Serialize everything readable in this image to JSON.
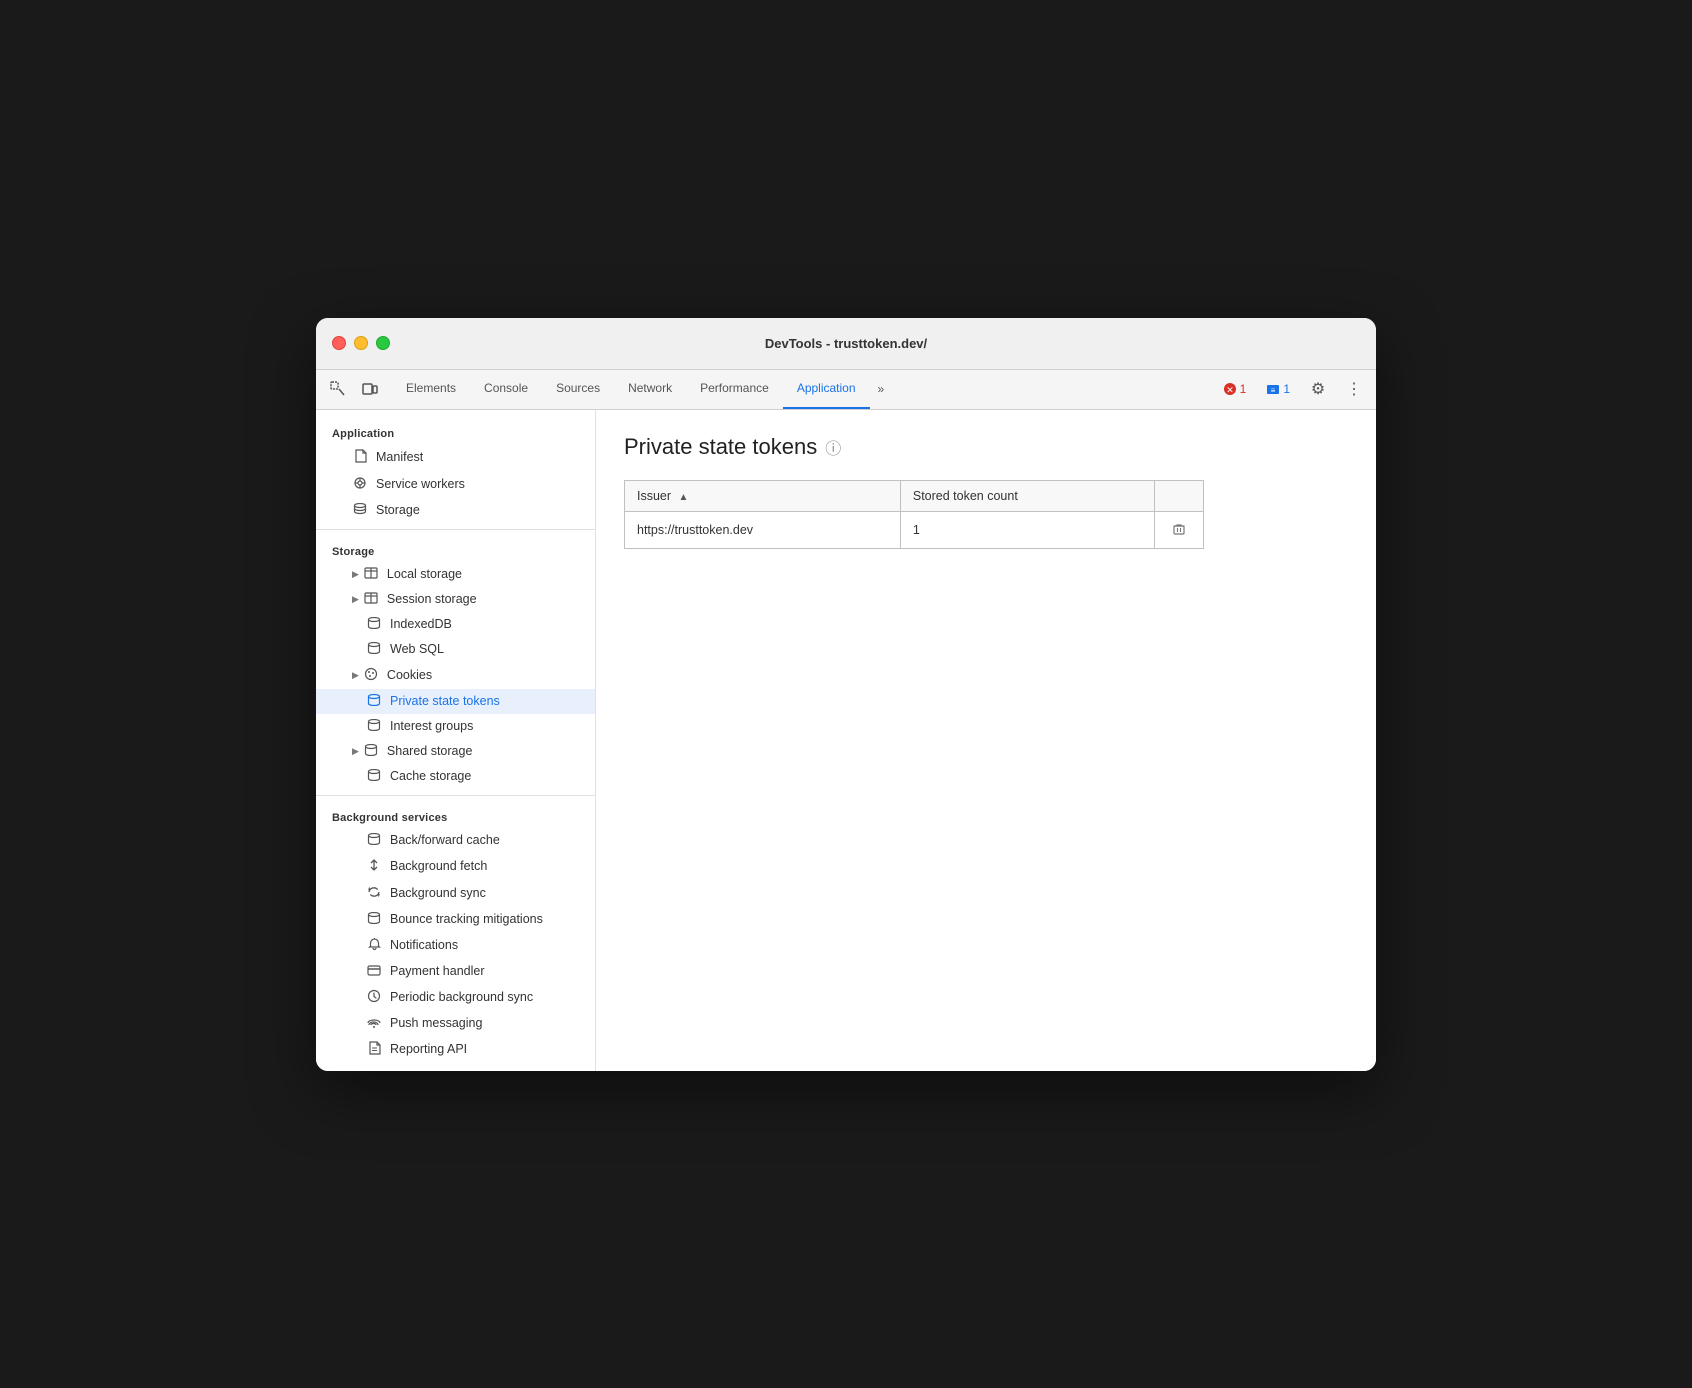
{
  "window": {
    "title": "DevTools - trusttoken.dev/"
  },
  "traffic_lights": {
    "close": "×",
    "minimize": "−",
    "maximize": "+"
  },
  "tabs": [
    {
      "label": "Elements",
      "active": false
    },
    {
      "label": "Console",
      "active": false
    },
    {
      "label": "Sources",
      "active": false
    },
    {
      "label": "Network",
      "active": false
    },
    {
      "label": "Performance",
      "active": false
    },
    {
      "label": "Application",
      "active": true
    }
  ],
  "tab_more": "»",
  "toolbar": {
    "error_count": "1",
    "info_count": "1",
    "settings_icon": "⚙",
    "more_icon": "⋮"
  },
  "sidebar": {
    "application_section": "Application",
    "application_items": [
      {
        "label": "Manifest",
        "icon": "📄",
        "icon_type": "file"
      },
      {
        "label": "Service workers",
        "icon": "⚙",
        "icon_type": "gear"
      },
      {
        "label": "Storage",
        "icon": "🗄",
        "icon_type": "storage"
      }
    ],
    "storage_section": "Storage",
    "storage_items": [
      {
        "label": "Local storage",
        "icon": "▶",
        "has_arrow": true,
        "icon_type": "grid"
      },
      {
        "label": "Session storage",
        "icon": "▶",
        "has_arrow": true,
        "icon_type": "grid"
      },
      {
        "label": "IndexedDB",
        "icon": "",
        "has_arrow": false,
        "icon_type": "storage"
      },
      {
        "label": "Web SQL",
        "icon": "",
        "has_arrow": false,
        "icon_type": "storage"
      },
      {
        "label": "Cookies",
        "icon": "▶",
        "has_arrow": true,
        "icon_type": "cookie"
      },
      {
        "label": "Private state tokens",
        "icon": "",
        "has_arrow": false,
        "icon_type": "storage",
        "active": true
      },
      {
        "label": "Interest groups",
        "icon": "",
        "has_arrow": false,
        "icon_type": "storage"
      },
      {
        "label": "Shared storage",
        "icon": "▶",
        "has_arrow": true,
        "icon_type": "storage"
      },
      {
        "label": "Cache storage",
        "icon": "",
        "has_arrow": false,
        "icon_type": "storage"
      }
    ],
    "background_section": "Background services",
    "background_items": [
      {
        "label": "Back/forward cache",
        "icon_type": "storage"
      },
      {
        "label": "Background fetch",
        "icon_type": "arrows"
      },
      {
        "label": "Background sync",
        "icon_type": "sync"
      },
      {
        "label": "Bounce tracking mitigations",
        "icon_type": "storage"
      },
      {
        "label": "Notifications",
        "icon_type": "bell"
      },
      {
        "label": "Payment handler",
        "icon_type": "card"
      },
      {
        "label": "Periodic background sync",
        "icon_type": "clock"
      },
      {
        "label": "Push messaging",
        "icon_type": "cloud"
      },
      {
        "label": "Reporting API",
        "icon_type": "file"
      }
    ]
  },
  "content": {
    "title": "Private state tokens",
    "table": {
      "columns": [
        {
          "label": "Issuer",
          "sortable": true
        },
        {
          "label": "Stored token count",
          "sortable": false
        }
      ],
      "rows": [
        {
          "issuer": "https://trusttoken.dev",
          "count": "1"
        }
      ]
    }
  }
}
